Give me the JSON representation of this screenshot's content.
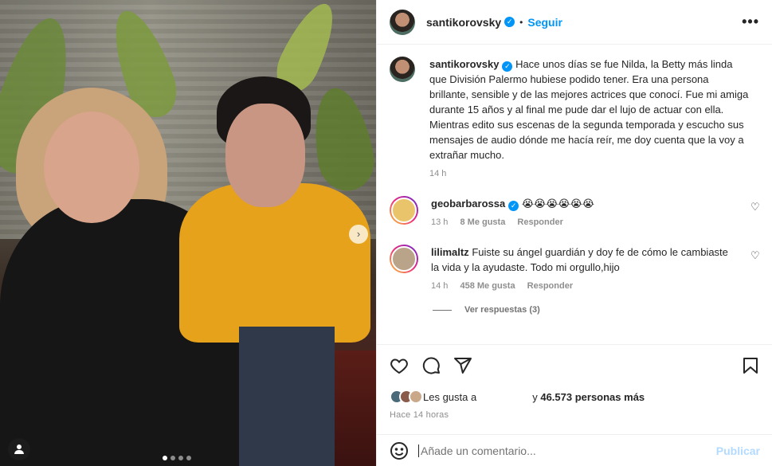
{
  "post": {
    "username": "santikorovsky",
    "follow_label": "Seguir",
    "separator": "•",
    "more_label": "•••",
    "caption": "Hace unos días se fue Nilda, la Betty más linda que División Palermo hubiese podido tener. Era una persona brillante, sensible y de las mejores actrices que conocí. Fue mi amiga durante 15 años y al final me pude dar el lujo de actuar con ella. Mientras edito sus escenas de la segunda temporada y escucho sus mensajes de audio dónde me hacía reír, me doy cuenta que la voy a extrañar mucho.",
    "caption_time": "14 h"
  },
  "comments": [
    {
      "username": "geobarbarossa",
      "verified": true,
      "text": "😭😭😭😭😭😭",
      "time": "13 h",
      "likes": "8 Me gusta",
      "reply_label": "Responder",
      "avatar_color": "#e9c46a"
    },
    {
      "username": "lilimaltz",
      "verified": false,
      "text": "Fuiste su ángel guardián y doy fe de cómo le cambiaste la vida y la ayudaste. Todo mi orgullo,hijo",
      "time": "14 h",
      "likes": "458 Me gusta",
      "reply_label": "Responder",
      "avatar_color": "#b9a48a",
      "view_replies": "Ver respuestas (3)"
    }
  ],
  "actions": {
    "liked_by_prefix": "Les gusta a",
    "liked_by_suffix": "y",
    "likes_count": "46.573 personas más",
    "timestamp": "Hace 14 horas"
  },
  "add_comment": {
    "placeholder": "Añade un comentario...",
    "publish_label": "Publicar"
  },
  "carousel": {
    "next_icon": "›",
    "total_slides": 4,
    "active_slide": 1
  },
  "colors": {
    "accent": "#0095f6",
    "text": "#262626",
    "secondary": "#8e8e8e"
  }
}
